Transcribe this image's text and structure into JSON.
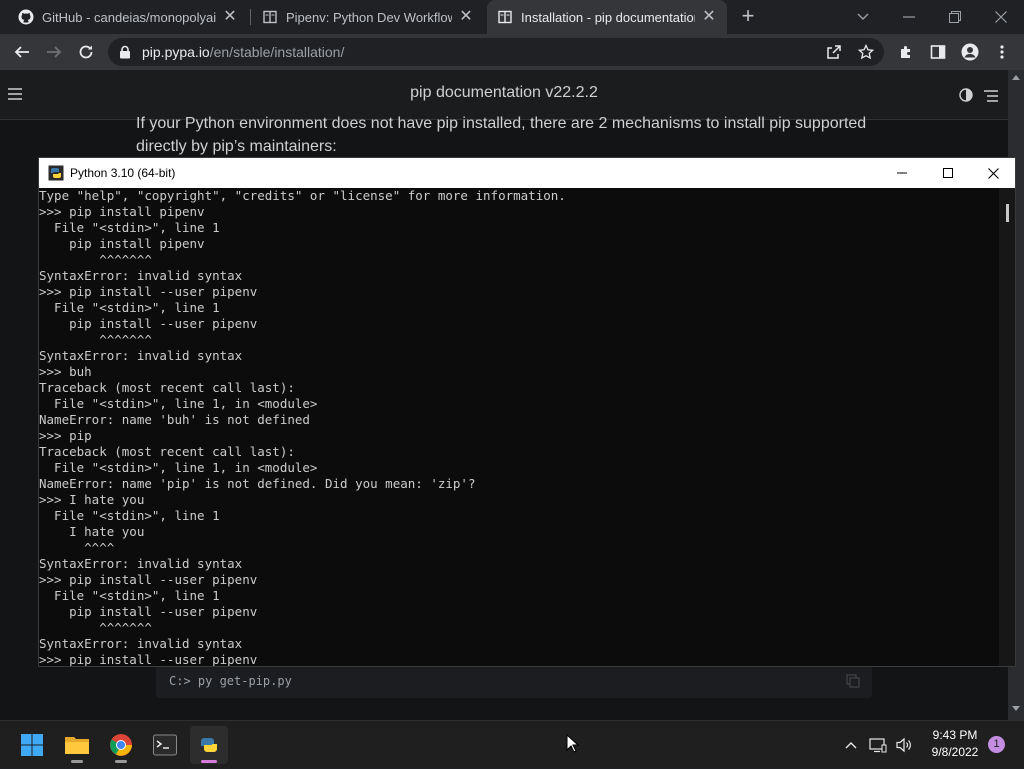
{
  "browser": {
    "tabs": [
      {
        "title": "GitHub - candeias/monopolyai: A",
        "icon": "github-icon"
      },
      {
        "title": "Pipenv: Python Dev Workflow for",
        "icon": "book-icon"
      },
      {
        "title": "Installation - pip documentation",
        "icon": "book-icon"
      }
    ],
    "url_host": "pip.pypa.io",
    "url_path": "/en/stable/installation/"
  },
  "doc": {
    "title": "pip documentation v22.2.2",
    "intro_line1": "If your Python environment does not have pip installed, there are 2 mechanisms to install pip supported",
    "intro_line2": "directly by pip’s maintainers:",
    "code_command": "C:> py get-pip.py"
  },
  "console": {
    "window_title": "Python 3.10 (64-bit)",
    "lines": [
      "Type \"help\", \"copyright\", \"credits\" or \"license\" for more information.",
      ">>> pip install pipenv",
      "  File \"<stdin>\", line 1",
      "    pip install pipenv",
      "        ^^^^^^^",
      "SyntaxError: invalid syntax",
      ">>> pip install --user pipenv",
      "  File \"<stdin>\", line 1",
      "    pip install --user pipenv",
      "        ^^^^^^^",
      "SyntaxError: invalid syntax",
      ">>> buh",
      "Traceback (most recent call last):",
      "  File \"<stdin>\", line 1, in <module>",
      "NameError: name 'buh' is not defined",
      ">>> pip",
      "Traceback (most recent call last):",
      "  File \"<stdin>\", line 1, in <module>",
      "NameError: name 'pip' is not defined. Did you mean: 'zip'?",
      ">>> I hate you",
      "  File \"<stdin>\", line 1",
      "    I hate you",
      "      ^^^^",
      "SyntaxError: invalid syntax",
      ">>> pip install --user pipenv",
      "  File \"<stdin>\", line 1",
      "    pip install --user pipenv",
      "        ^^^^^^^",
      "SyntaxError: invalid syntax",
      ">>> pip install --user pipenv"
    ]
  },
  "taskbar": {
    "time": "9:43 PM",
    "date": "9/8/2022",
    "notification_count": "1",
    "apps": [
      "start-icon",
      "file-explorer-icon",
      "chrome-icon",
      "terminal-icon",
      "python-icon"
    ]
  }
}
